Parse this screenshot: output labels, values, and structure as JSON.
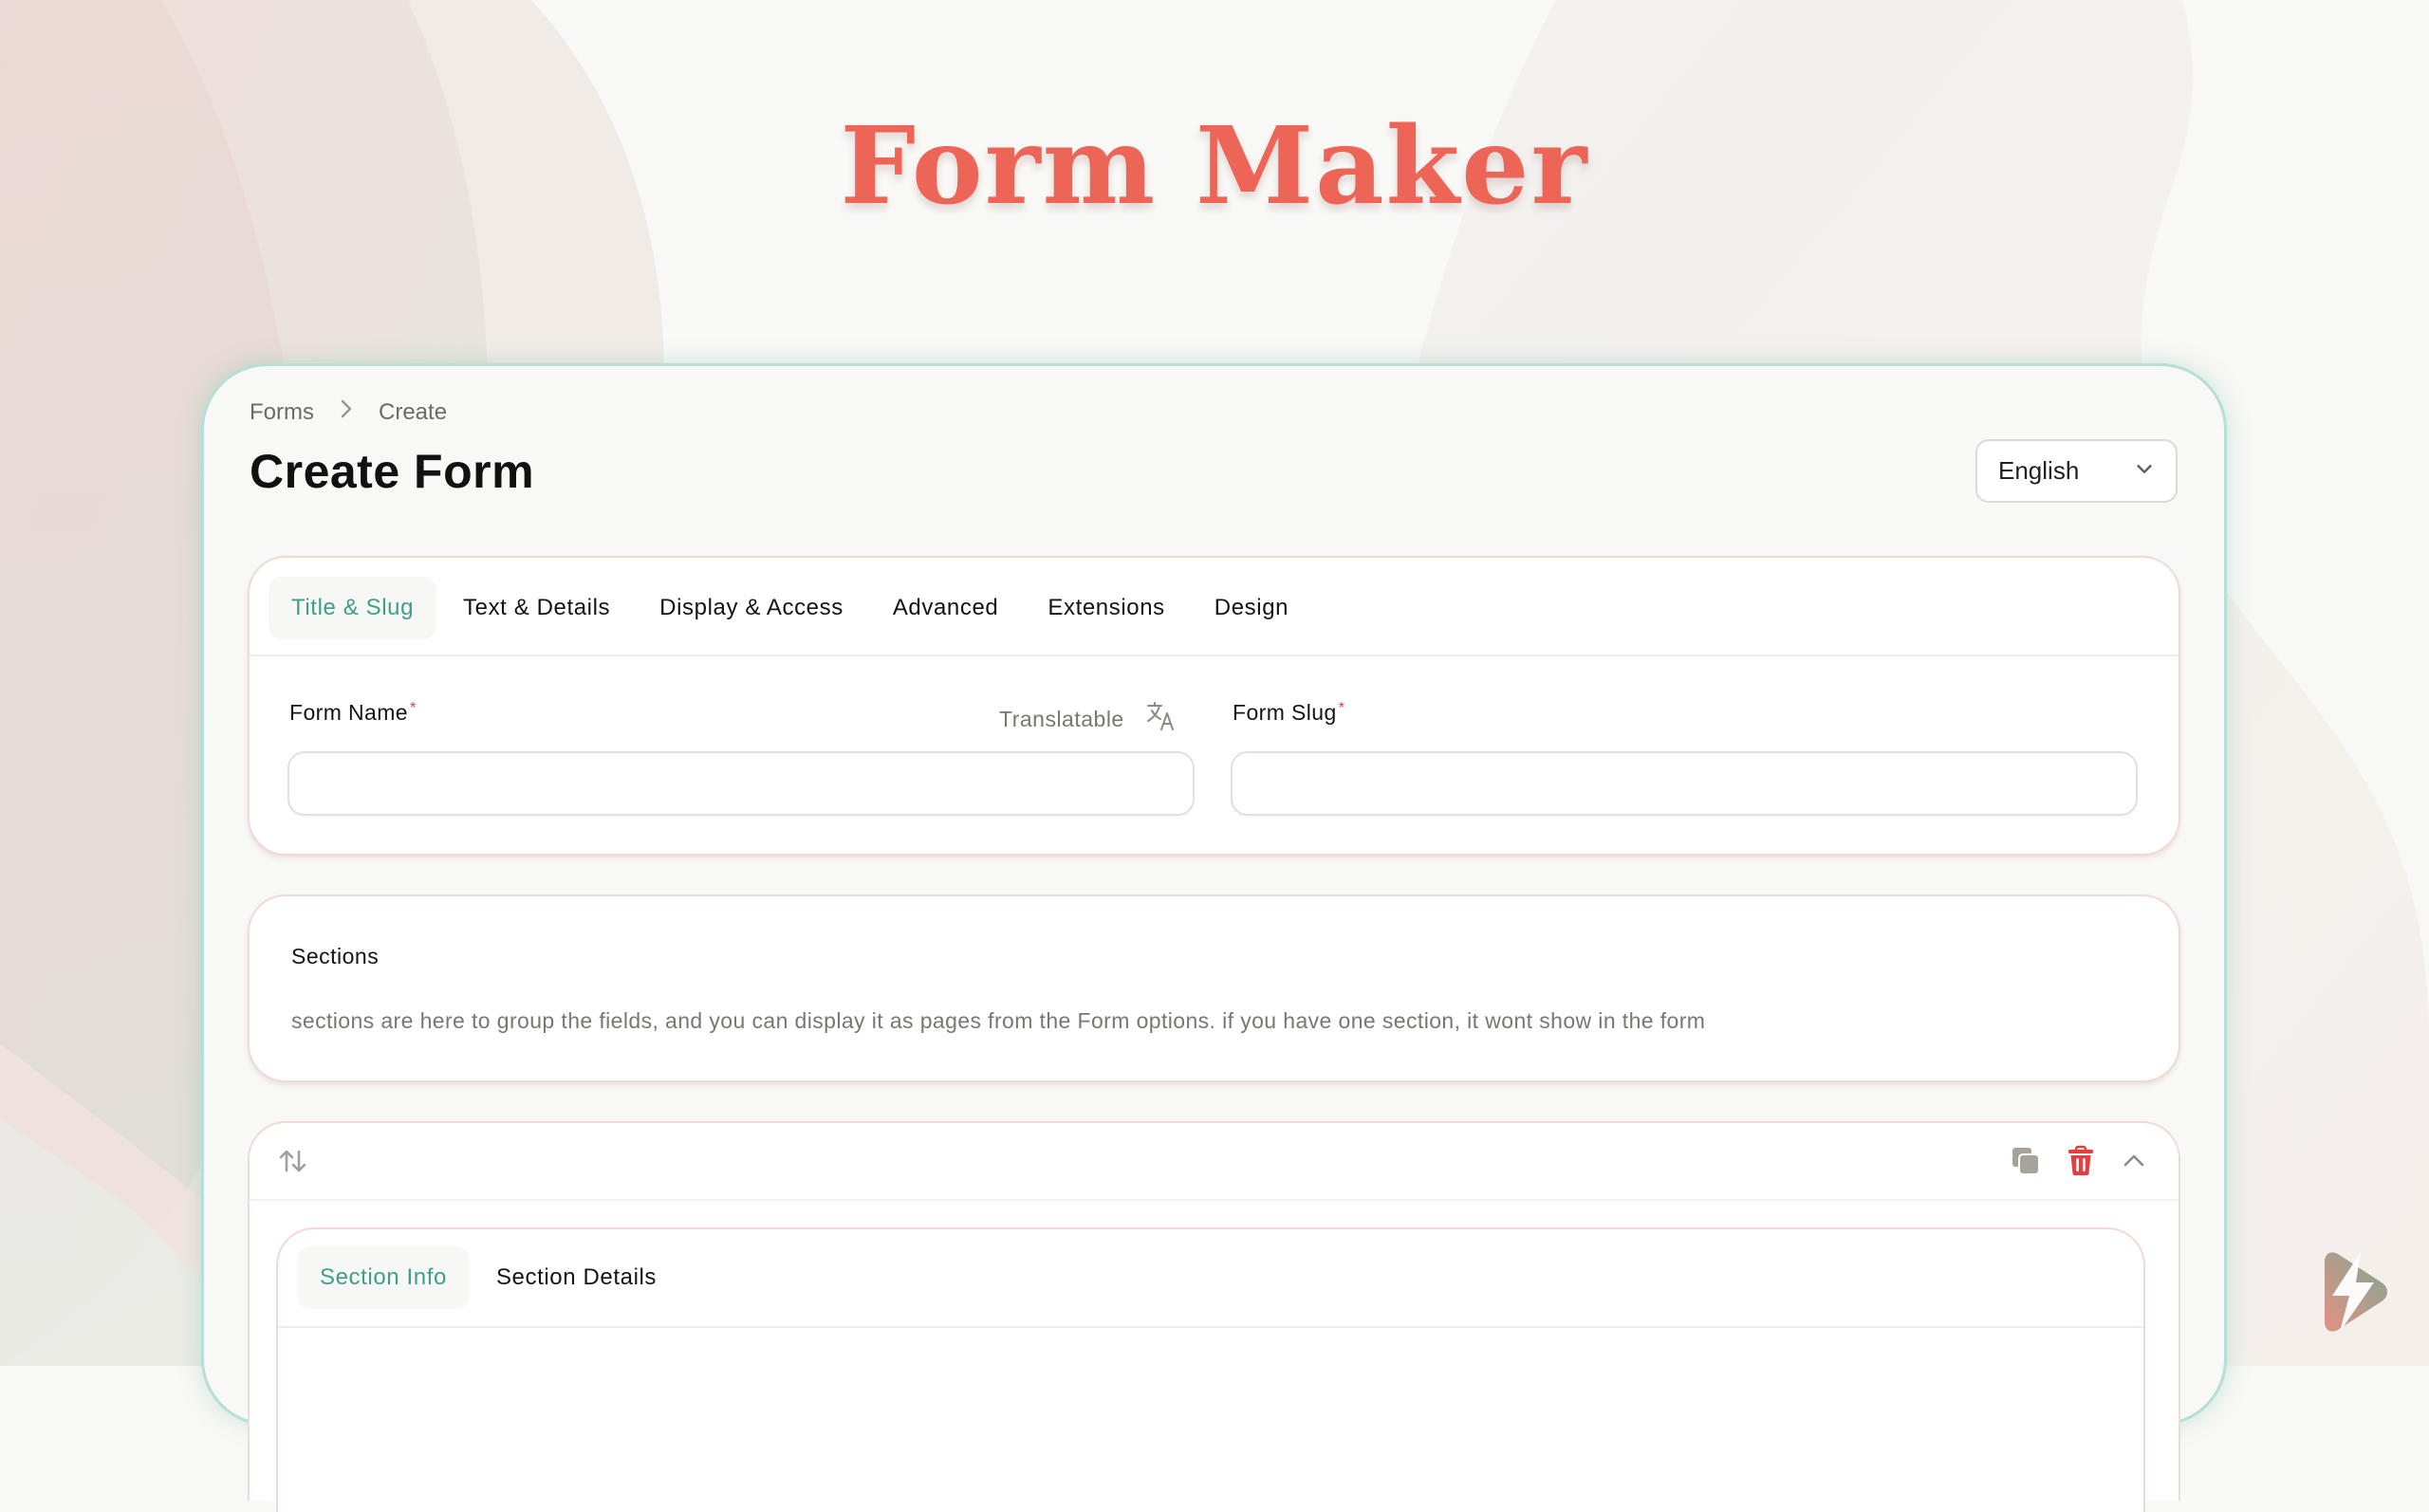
{
  "hero": {
    "title": "Form Maker"
  },
  "breadcrumb": {
    "items": [
      "Forms",
      "Create"
    ]
  },
  "page": {
    "title": "Create Form"
  },
  "language_select": {
    "value": "English"
  },
  "form_tabs": [
    {
      "label": "Title & Slug",
      "active": true
    },
    {
      "label": "Text & Details",
      "active": false
    },
    {
      "label": "Display & Access",
      "active": false
    },
    {
      "label": "Advanced",
      "active": false
    },
    {
      "label": "Extensions",
      "active": false
    },
    {
      "label": "Design",
      "active": false
    }
  ],
  "fields": {
    "form_name": {
      "label": "Form Name",
      "required_mark": "*",
      "value": "",
      "placeholder": "",
      "hint": "Translatable"
    },
    "form_slug": {
      "label": "Form Slug",
      "required_mark": "*",
      "value": "",
      "placeholder": ""
    }
  },
  "sections": {
    "title": "Sections",
    "description": "sections are here to group the fields, and you can display it as pages from the Form options. if you have one section, it wont show in the form"
  },
  "section_item": {
    "icons": [
      "reorder-icon",
      "clone-icon",
      "delete-icon",
      "chevron-up-icon"
    ],
    "tabs": [
      {
        "label": "Section Info",
        "active": true
      },
      {
        "label": "Section Details",
        "active": false
      }
    ]
  },
  "colors": {
    "accent": "#3d9e8a",
    "hero_title": "#ec6557",
    "danger": "#e53e3e",
    "card_border": "#b6e0d5",
    "panel_border": "#f1d9d4"
  }
}
